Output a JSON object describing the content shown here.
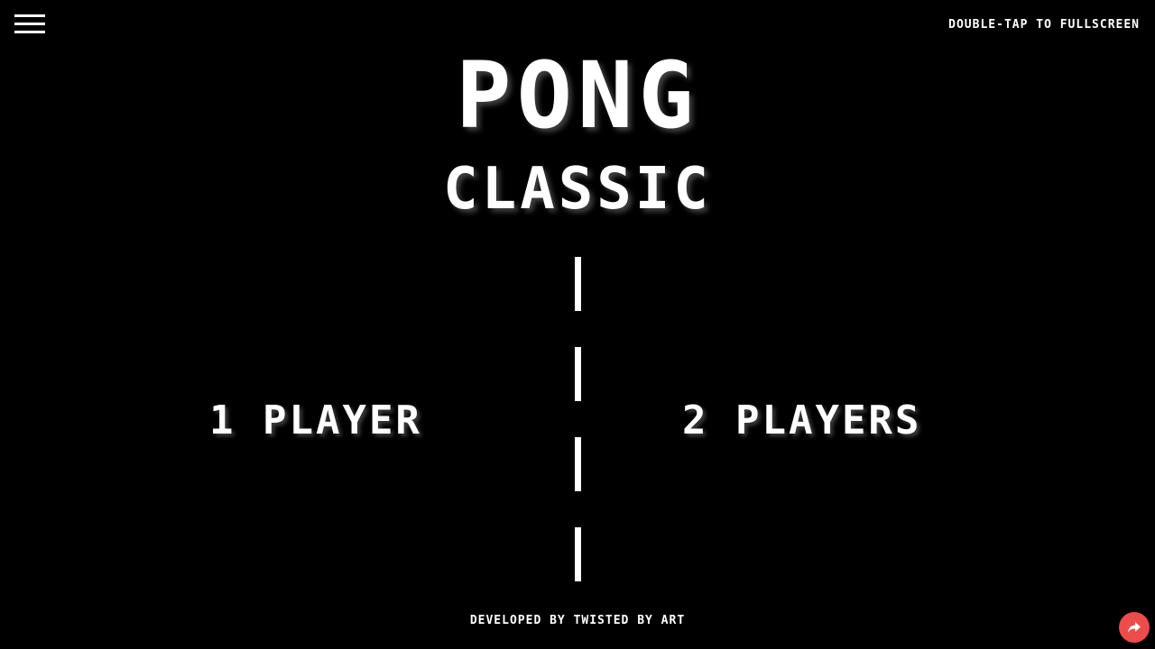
{
  "header": {
    "menu_icon": "hamburger-menu-icon",
    "fullscreen_hint": "DOUBLE-TAP TO FULLSCREEN"
  },
  "title": {
    "main": "PONG",
    "sub": "CLASSIC"
  },
  "menu_options": {
    "one_player": "1 PLAYER",
    "two_players": "2 PLAYERS"
  },
  "footer": {
    "credits": "DEVELOPED BY TWISTED BY ART",
    "share_icon": "share-arrow-icon"
  },
  "colors": {
    "background": "#000000",
    "foreground": "#ffffff",
    "share_button": "#ee4b4b"
  }
}
